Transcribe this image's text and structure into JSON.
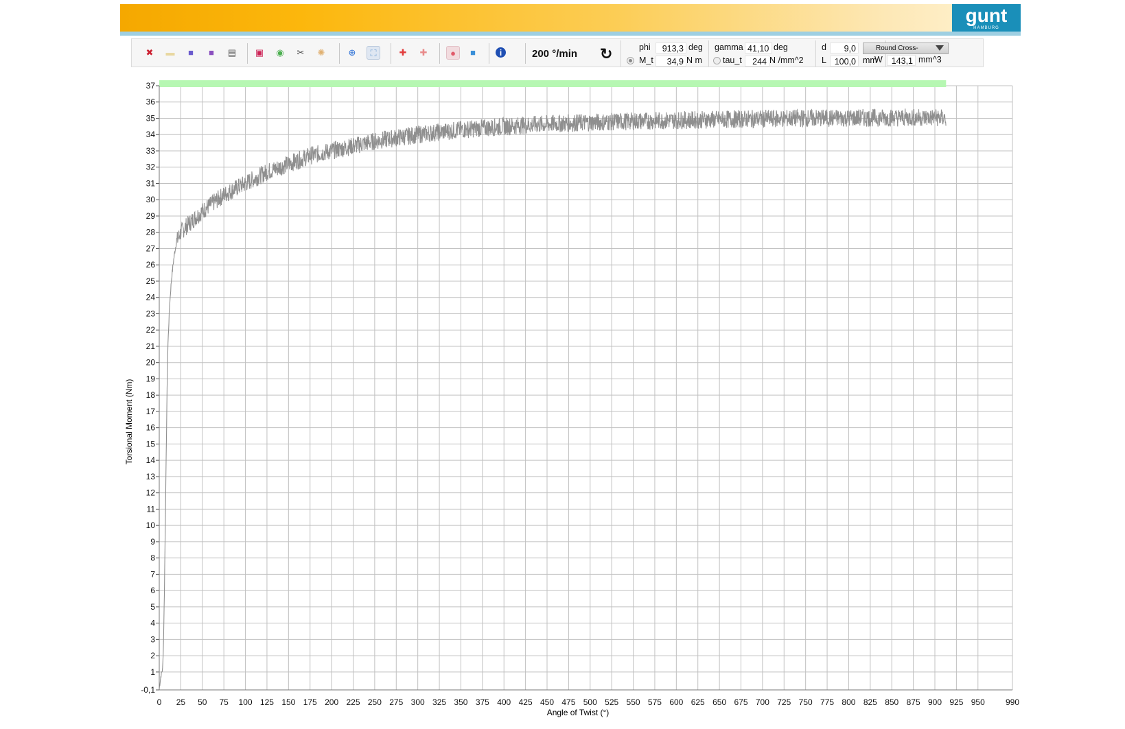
{
  "toolbar": {
    "buttons": [
      {
        "name": "close-icon",
        "glyph": "✖",
        "color": "#cc2233"
      },
      {
        "name": "open-folder-icon",
        "glyph": "▬",
        "color": "#e8d7a0"
      },
      {
        "name": "save-icon",
        "glyph": "■",
        "color": "#6a5acd"
      },
      {
        "name": "save-as-icon",
        "glyph": "■",
        "color": "#8a4fbf"
      },
      {
        "name": "print-icon",
        "glyph": "▤",
        "color": "#555555"
      },
      {
        "name": "record-list-icon",
        "glyph": "▣",
        "color": "#cc2255"
      },
      {
        "name": "color-wheel-icon",
        "glyph": "◉",
        "color": "#4caf50"
      },
      {
        "name": "tools-icon",
        "glyph": "✂",
        "color": "#444444"
      },
      {
        "name": "settings-icon",
        "glyph": "✺",
        "color": "#e0b070"
      },
      {
        "name": "crosshair-icon",
        "glyph": "⊕",
        "color": "#2a6fd6"
      },
      {
        "name": "zoom-fit-icon",
        "glyph": "⛶",
        "color": "#7aa7d6"
      },
      {
        "name": "pin-add-icon",
        "glyph": "✚",
        "color": "#e23c3c"
      },
      {
        "name": "pin-remove-icon",
        "glyph": "✚",
        "color": "#e88a8a"
      },
      {
        "name": "record-icon",
        "glyph": "●",
        "color": "#e05a6a"
      },
      {
        "name": "stop-icon",
        "glyph": "■",
        "color": "#3a8fd8"
      },
      {
        "name": "info-icon",
        "glyph": "i",
        "color": "#1f4fb3"
      }
    ],
    "speed": "200 °/min",
    "refresh_glyph": "↻"
  },
  "readouts": {
    "phi_label": "phi",
    "phi_value": "913,3",
    "phi_unit": "deg",
    "mt_label": "M_t",
    "mt_value": "34,9",
    "mt_unit": "N m",
    "gamma_label": "gamma",
    "gamma_value": "41,10",
    "gamma_unit": "deg",
    "tau_label": "tau_t",
    "tau_value": "244",
    "tau_unit": "N /mm^2",
    "d_label": "d",
    "d_value": "9,0",
    "d_unit": "mm",
    "l_label": "L",
    "l_value": "100,0",
    "l_unit": "mm",
    "cross_section": "Round Cross-",
    "w_label": "W",
    "w_value": "143,1",
    "w_unit": "mm^3"
  },
  "logo": {
    "text": "gunt",
    "sub": "HAMBURG"
  },
  "chart_data": {
    "type": "line",
    "xlabel": "Angle of Twist (°)",
    "ylabel": "Torsional Moment (Nm)",
    "xlim": [
      0,
      990
    ],
    "ylim": [
      -0.1,
      37
    ],
    "x_ticks": [
      "0",
      "25",
      "50",
      "75",
      "100",
      "125",
      "150",
      "175",
      "200",
      "225",
      "250",
      "275",
      "300",
      "325",
      "350",
      "375",
      "400",
      "425",
      "450",
      "475",
      "500",
      "525",
      "550",
      "575",
      "600",
      "625",
      "650",
      "675",
      "700",
      "725",
      "750",
      "775",
      "800",
      "825",
      "850",
      "875",
      "900",
      "925",
      "950",
      "990"
    ],
    "y_ticks": [
      "-0,1",
      "1",
      "2",
      "3",
      "4",
      "5",
      "6",
      "7",
      "8",
      "9",
      "10",
      "11",
      "12",
      "13",
      "14",
      "15",
      "16",
      "17",
      "18",
      "19",
      "20",
      "21",
      "22",
      "23",
      "24",
      "25",
      "26",
      "27",
      "28",
      "29",
      "30",
      "31",
      "32",
      "33",
      "34",
      "35",
      "36",
      "37"
    ],
    "grid": true,
    "progress_bar": {
      "x_start": 0,
      "x_end": 913,
      "color": "#b6f7b2"
    },
    "series": [
      {
        "color": "#8f8f8f",
        "x": [
          0,
          2,
          4,
          5,
          6,
          7,
          8,
          9,
          10,
          12,
          14,
          16,
          18,
          20,
          25,
          30,
          40,
          50,
          60,
          75,
          100,
          125,
          150,
          175,
          200,
          225,
          250,
          275,
          300,
          325,
          350,
          375,
          400,
          450,
          500,
          550,
          600,
          650,
          700,
          750,
          800,
          850,
          900,
          913
        ],
        "y": [
          0,
          0.8,
          1.2,
          3,
          6,
          10,
          14,
          18,
          21,
          23.5,
          25,
          26,
          26.8,
          27.4,
          28.0,
          28.3,
          28.8,
          29.3,
          29.7,
          30.3,
          31.0,
          31.7,
          32.2,
          32.7,
          33.0,
          33.3,
          33.6,
          33.8,
          34.0,
          34.15,
          34.3,
          34.4,
          34.5,
          34.65,
          34.75,
          34.82,
          34.88,
          34.93,
          34.97,
          35.0,
          35.02,
          35.04,
          35.05,
          35.0
        ]
      }
    ]
  }
}
